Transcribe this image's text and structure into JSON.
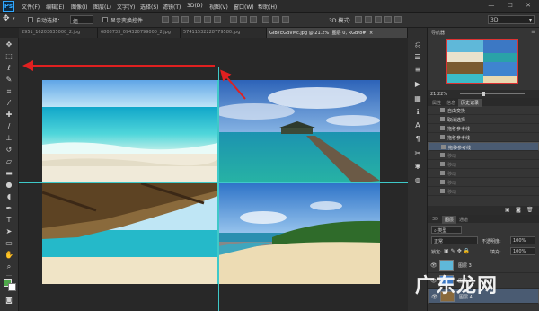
{
  "app": {
    "logo_text": "Ps"
  },
  "menu": [
    "文件(F)",
    "编辑(E)",
    "图像(I)",
    "图层(L)",
    "文字(Y)",
    "选择(S)",
    "滤镜(T)",
    "3D(D)",
    "视图(V)",
    "窗口(W)",
    "帮助(H)"
  ],
  "window_controls": "— ☐ ✕",
  "options": {
    "auto_select_label": "自动选择：",
    "auto_select_value": "组",
    "show_transform_label": "显示变换控件",
    "mode_3d_label": "3D 模式:",
    "workspace_value": "3D"
  },
  "tabs": [
    "2951_16203635000_2.jpg",
    "6808733_094320799000_2.jpg",
    "57411532228779580.jpg",
    "GIB7EGBVMc.jpg @ 21.2% (图层 0, RGB/8#) ×"
  ],
  "navigator": {
    "title": "导航器",
    "zoom": "21.22%"
  },
  "history": {
    "tabs": [
      "属性",
      "信息",
      "历史记录"
    ],
    "items": [
      {
        "label": "自由变换",
        "state": "normal"
      },
      {
        "label": "取消选择",
        "state": "normal"
      },
      {
        "label": "拖移参考线",
        "state": "normal"
      },
      {
        "label": "拖移参考线",
        "state": "normal"
      },
      {
        "label": "拖移参考线",
        "state": "selected"
      },
      {
        "label": "移动",
        "state": "dim"
      },
      {
        "label": "移动",
        "state": "dim"
      },
      {
        "label": "移动",
        "state": "dim"
      },
      {
        "label": "移动",
        "state": "dim"
      },
      {
        "label": "移动",
        "state": "dim"
      }
    ]
  },
  "layers": {
    "tabs": [
      "3D",
      "图层",
      "通道"
    ],
    "filter_value": "类型",
    "blend_mode": "正常",
    "opacity_label": "不透明度:",
    "opacity_value": "100%",
    "lock_label": "锁定:",
    "fill_label": "填充:",
    "fill_value": "100%",
    "items": [
      {
        "name": "图层 3",
        "selected": false
      },
      {
        "name": "图层 2",
        "selected": false
      },
      {
        "name": "图层 4",
        "selected": true
      }
    ]
  },
  "watermark": "广东龙网",
  "colors": {
    "accent": "#31a8ff",
    "guide": "#3ec9c9",
    "annotation_arrow": "#e02020",
    "foreground": "#4fa84a",
    "background": "#ffffff"
  }
}
